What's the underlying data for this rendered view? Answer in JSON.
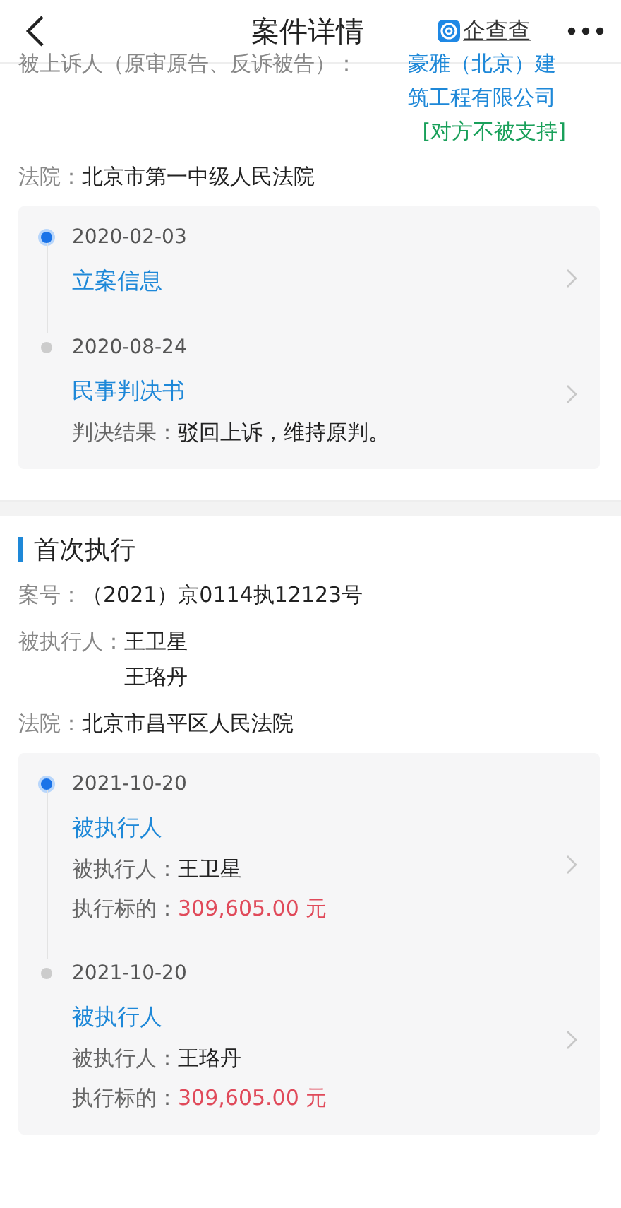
{
  "header": {
    "title": "案件详情",
    "brand": "企查查"
  },
  "party": {
    "label": "被上诉人（原审原告、反诉被告）：",
    "name": "豪雅（北京）建筑工程有限公司",
    "status": "[对方不被支持]"
  },
  "court": {
    "label": "法院：",
    "value": "北京市第一中级人民法院"
  },
  "timeline": [
    {
      "active": true,
      "date": "2020-02-03",
      "title": "立案信息"
    },
    {
      "active": false,
      "date": "2020-08-24",
      "title": "民事判决书",
      "details": [
        {
          "label": "判决结果：",
          "value": "驳回上诉，维持原判。",
          "kind": "text"
        }
      ]
    }
  ],
  "section": {
    "title": "首次执行",
    "fields": [
      {
        "label": "案号：",
        "values": [
          "（2021）京0114执12123号"
        ]
      },
      {
        "label": "被执行人：",
        "values": [
          "王卫星",
          "王珞丹"
        ]
      },
      {
        "label": "法院：",
        "values": [
          "北京市昌平区人民法院"
        ]
      }
    ],
    "timeline": [
      {
        "active": true,
        "date": "2021-10-20",
        "title": "被执行人",
        "details": [
          {
            "label": "被执行人：",
            "value": "王卫星",
            "kind": "text"
          },
          {
            "label": "执行标的：",
            "value": "309,605.00 元",
            "kind": "amount"
          }
        ]
      },
      {
        "active": false,
        "date": "2021-10-20",
        "title": "被执行人",
        "details": [
          {
            "label": "被执行人：",
            "value": "王珞丹",
            "kind": "text"
          },
          {
            "label": "执行标的：",
            "value": "309,605.00 元",
            "kind": "amount"
          }
        ]
      }
    ]
  }
}
